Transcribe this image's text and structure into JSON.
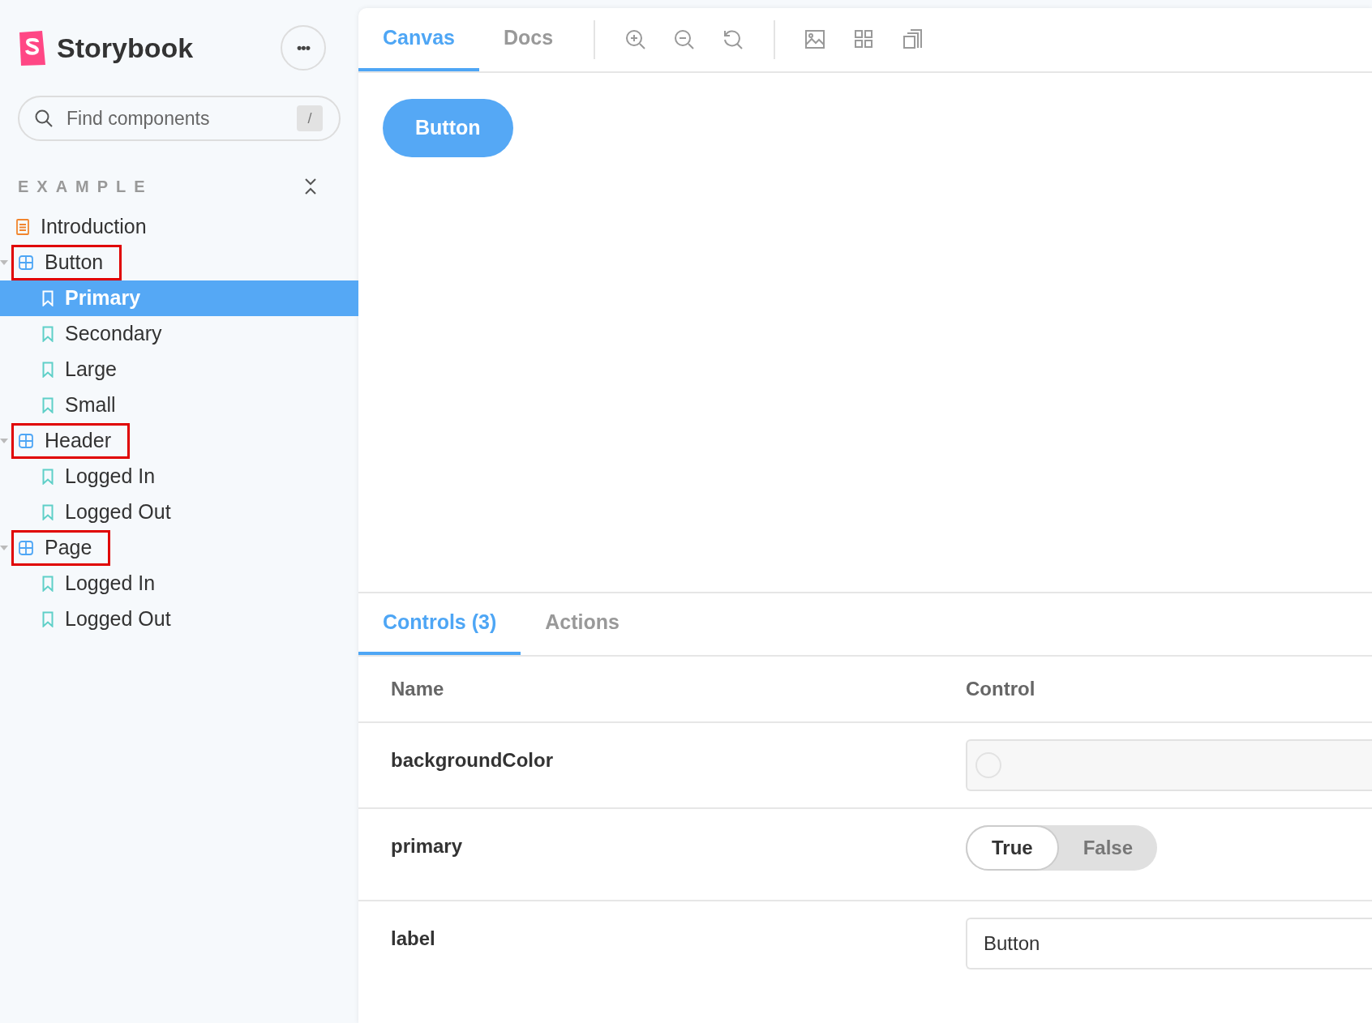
{
  "sidebar": {
    "brand": "Storybook",
    "menu_button": "•••",
    "search": {
      "placeholder": "Find components",
      "shortcut": "/"
    },
    "section": {
      "title": "EXAMPLE"
    },
    "tree": [
      {
        "kind": "doc",
        "label": "Introduction",
        "selected": false,
        "outlined": false
      },
      {
        "kind": "component",
        "label": "Button",
        "selected": false,
        "outlined": true,
        "expanded": true,
        "children": [
          {
            "kind": "story",
            "label": "Primary",
            "selected": true,
            "outlined": false
          },
          {
            "kind": "story",
            "label": "Secondary",
            "selected": false,
            "outlined": false
          },
          {
            "kind": "story",
            "label": "Large",
            "selected": false,
            "outlined": false
          },
          {
            "kind": "story",
            "label": "Small",
            "selected": false,
            "outlined": false
          }
        ]
      },
      {
        "kind": "component",
        "label": "Header",
        "selected": false,
        "outlined": true,
        "expanded": true,
        "children": [
          {
            "kind": "story",
            "label": "Logged In",
            "selected": false,
            "outlined": false
          },
          {
            "kind": "story",
            "label": "Logged Out",
            "selected": false,
            "outlined": false
          }
        ]
      },
      {
        "kind": "component",
        "label": "Page",
        "selected": false,
        "outlined": true,
        "expanded": true,
        "children": [
          {
            "kind": "story",
            "label": "Logged In",
            "selected": false,
            "outlined": false
          },
          {
            "kind": "story",
            "label": "Logged Out",
            "selected": false,
            "outlined": false
          }
        ]
      }
    ]
  },
  "toolbar": {
    "tabs": [
      {
        "label": "Canvas",
        "selected": true
      },
      {
        "label": "Docs",
        "selected": false
      }
    ],
    "tools": [
      {
        "kind": "zoom-in"
      },
      {
        "kind": "zoom-out"
      },
      {
        "kind": "zoom-reset"
      },
      {
        "kind": "divider"
      },
      {
        "kind": "background"
      },
      {
        "kind": "grid"
      },
      {
        "kind": "outline"
      }
    ]
  },
  "preview": {
    "button": "Button"
  },
  "addons": {
    "tabs": [
      {
        "label": "Controls (3)",
        "selected": true
      },
      {
        "label": "Actions",
        "selected": false
      }
    ],
    "columns": [
      "Name",
      "Control"
    ],
    "rows": [
      {
        "kind": "color",
        "name": "backgroundColor"
      },
      {
        "kind": "boolean",
        "name": "primary",
        "options": [
          {
            "label": "True",
            "selected": true
          },
          {
            "label": "False",
            "selected": false
          }
        ]
      },
      {
        "kind": "text",
        "name": "label",
        "value": "Button"
      }
    ]
  }
}
